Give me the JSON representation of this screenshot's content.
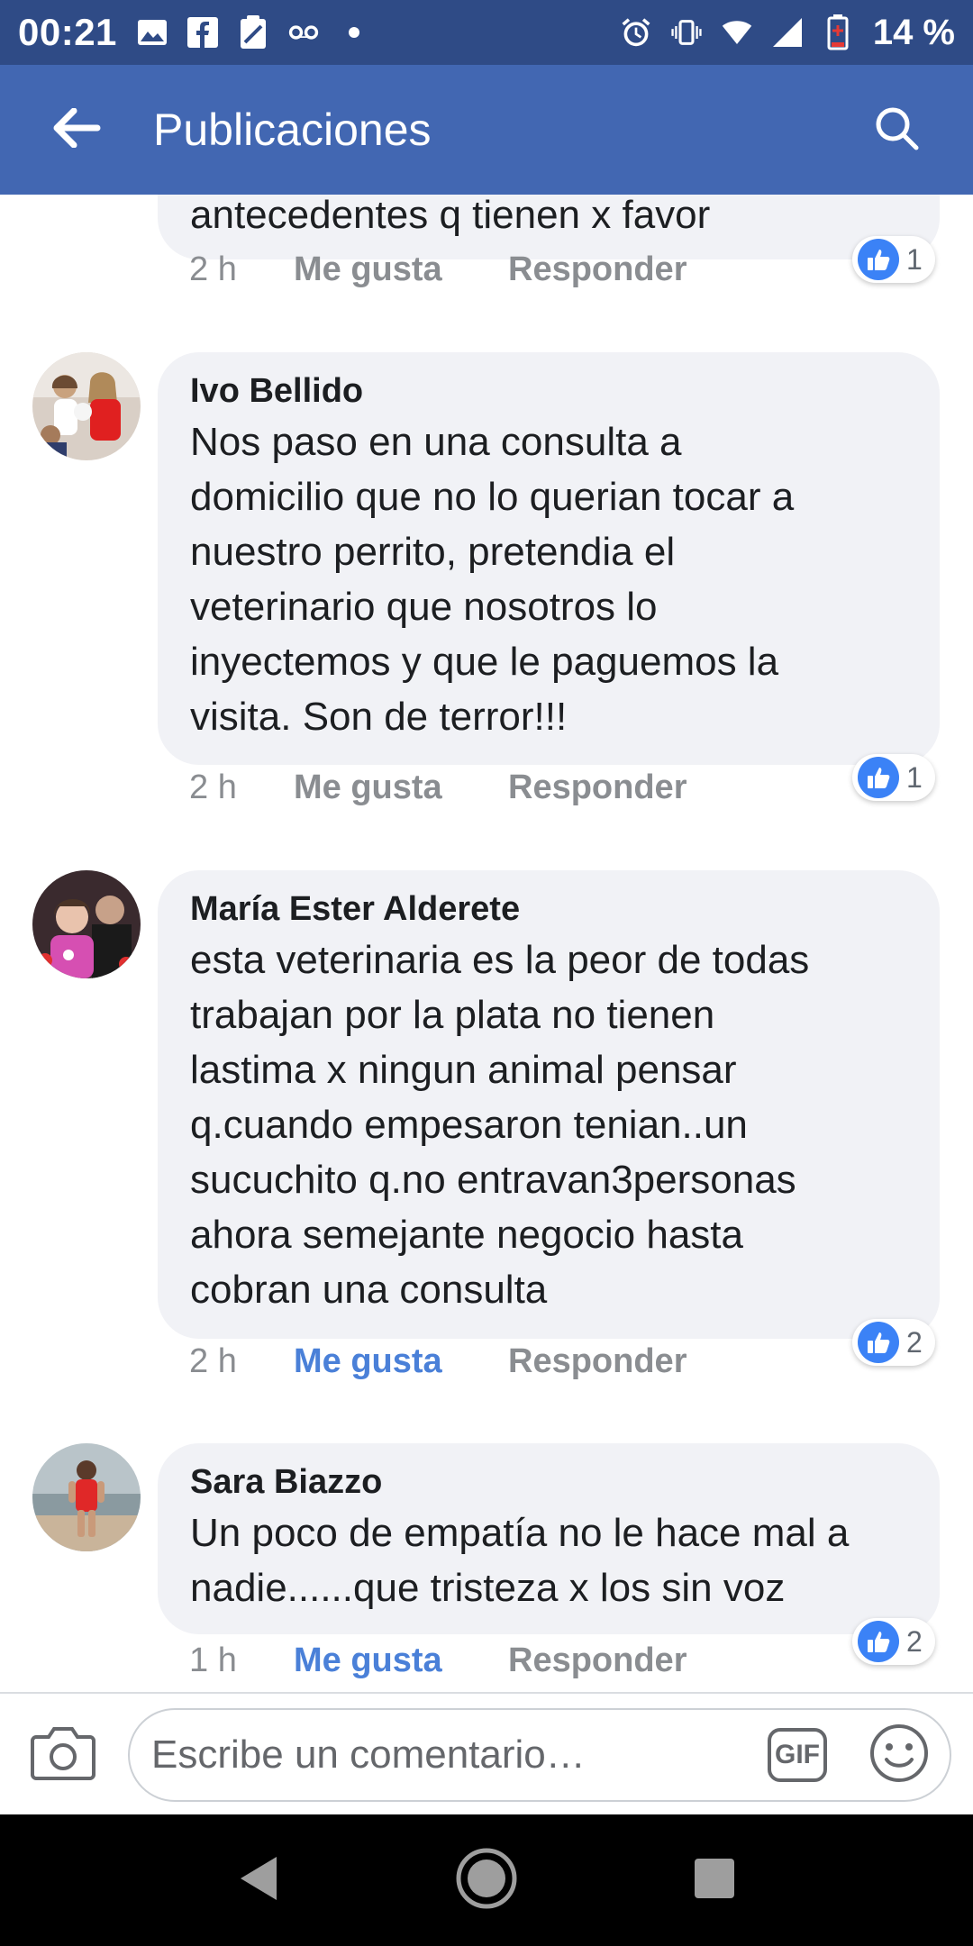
{
  "status_bar": {
    "time": "00:21",
    "battery": "14 %",
    "icons_left": [
      "image-icon",
      "facebook-icon",
      "note-icon",
      "voicemail-icon",
      "dot-icon"
    ],
    "icons_right": [
      "alarm-icon",
      "vibrate-icon",
      "wifi-icon",
      "signal-icon",
      "battery-icon"
    ]
  },
  "app_bar": {
    "title": "Publicaciones",
    "back_icon": "arrow-left-icon",
    "search_icon": "search-icon"
  },
  "comments": [
    {
      "author": "",
      "text": "antecedentes q tienen x favor",
      "time": "2 h",
      "like_label": "Me gusta",
      "reply_label": "Responder",
      "liked": false,
      "reaction_count": "1"
    },
    {
      "author": "Ivo Bellido",
      "text": "Nos paso en una consulta a\ndomicilio que no lo querian tocar a\nnuestro perrito, pretendia el\nveterinario que nosotros lo\ninyectemos y que le paguemos la\nvisita. Son de terror!!!",
      "time": "2 h",
      "like_label": "Me gusta",
      "reply_label": "Responder",
      "liked": false,
      "reaction_count": "1"
    },
    {
      "author": "María Ester Alderete",
      "text": "esta veterinaria es la peor de todas\ntrabajan por la  plata no tienen\nlastima x ningun  animal pensar\nq.cuando empesaron tenian..un\nsucuchito q.no entravan3personas\nahora semejante negocio hasta\ncobran una consulta",
      "time": "2 h",
      "like_label": "Me gusta",
      "reply_label": "Responder",
      "liked": true,
      "reaction_count": "2"
    },
    {
      "author": "Sara Biazzo",
      "text": "Un poco de empatía no le hace mal a\nnadie......que tristeza x los sin voz",
      "time": "1 h",
      "like_label": "Me gusta",
      "reply_label": "Responder",
      "liked": true,
      "reaction_count": "2"
    }
  ],
  "composer": {
    "placeholder": "Escribe un comentario…",
    "gif_label": "GIF",
    "camera_icon": "camera-icon",
    "emoji_icon": "emoji-icon"
  },
  "nav_bar": {
    "icons": [
      "back-triangle-icon",
      "home-circle-icon",
      "recents-square-icon"
    ]
  },
  "colors": {
    "status_bar": "#2f4b86",
    "app_bar": "#4267b2",
    "bubble": "#f1f2f6",
    "liked_text": "#4a80d8",
    "meta_text": "#8a8d91",
    "like_badge": "#3b82f6"
  }
}
